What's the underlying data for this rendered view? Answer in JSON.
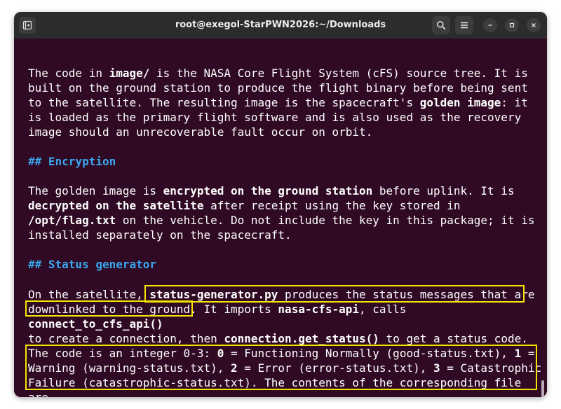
{
  "window": {
    "title": "root@exegol-StarPWN2026:~/Downloads"
  },
  "icons": {
    "new_tab": "new-tab-icon",
    "search": "search-icon",
    "menu": "hamburger-menu-icon",
    "minimize": "minimize-icon",
    "maximize": "maximize-icon",
    "close": "close-icon"
  },
  "colors": {
    "terminal_bg": "#300a24",
    "text": "#ffffff",
    "heading": "#3aa8f0",
    "highlight_box": "#f5e400"
  },
  "terminal": {
    "p1": {
      "l1a": "The code in ",
      "l1b": "image/",
      "l1c": " is the NASA Core Flight System (cFS) source tree. It is",
      "l2": "built on the ground station to produce the flight binary before being sent",
      "l3a": "to the satellite. The resulting image is the spacecraft's ",
      "l3b": "golden image",
      "l3c": ": it",
      "l4": "is loaded as the primary flight software and is also used as the recovery",
      "l5": "image should an unrecoverable fault occur on orbit."
    },
    "h1": "## Encryption",
    "p2": {
      "l1a": "The golden image is ",
      "l1b": "encrypted on the ground station",
      "l1c": " before uplink. It is",
      "l2a": "decrypted on the satellite",
      "l2b": " after receipt using the key stored in",
      "l3a": "/opt/flag.txt",
      "l3b": " on the vehicle. Do not include the key in this package; it is",
      "l4": "installed separately on the spacecraft."
    },
    "h2": "## Status generator",
    "p3": {
      "l1a": "On the satellite, ",
      "l1b": "status-generator.py",
      "l1c": " produces the status messages that are",
      "l2a": "downlinked to the ground.",
      "l2b": " It imports ",
      "l2c": "nasa-cfs-api",
      "l2d": ", calls",
      "l3": "connect_to_cfs_api()",
      "l4a": "to create a connection, then ",
      "l4b": "connection.get_status()",
      "l4c": " to get a status code.",
      "l5a": "The code is an integer 0-3: ",
      "l5b": "0",
      "l5c": " = Functioning Normally (good-status.txt), ",
      "l5d": "1",
      "l5e": " =",
      "l6a": "Warning (warning-status.txt), ",
      "l6b": "2",
      "l6c": " = Error (error-status.txt), ",
      "l6d": "3",
      "l6e": " = Catastrophic",
      "l7": "Failure (catastrophic-status.txt). The contents of the corresponding file",
      "l8": "are"
    }
  }
}
